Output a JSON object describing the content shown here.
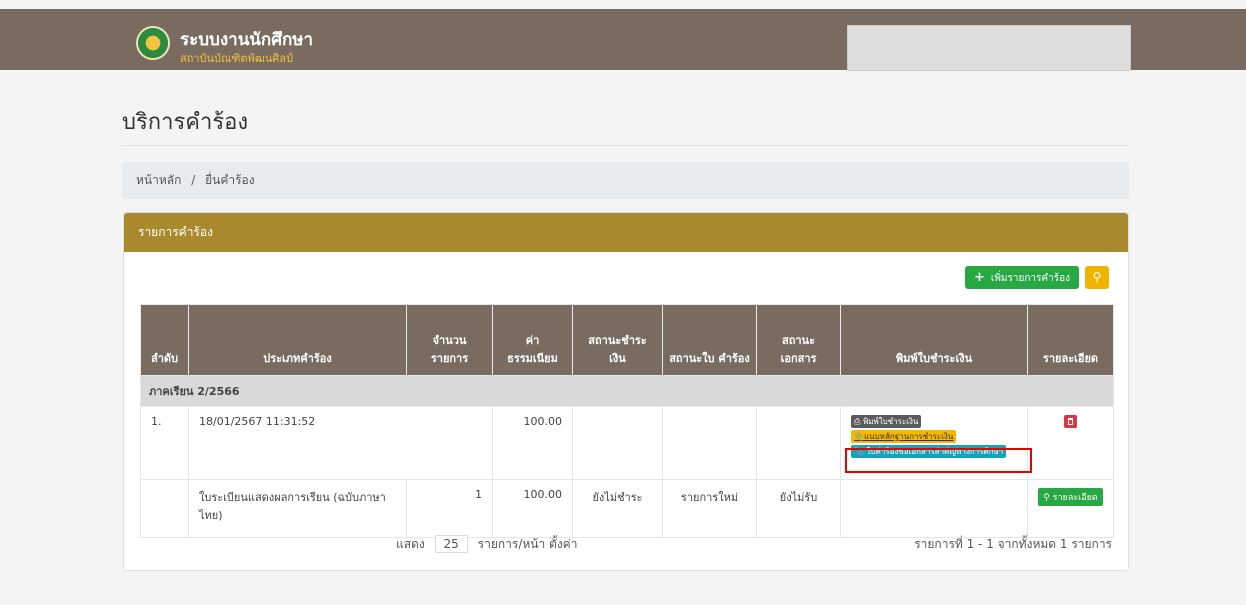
{
  "header": {
    "title": "ระบบงานนักศึกษา",
    "subtitle": "สถาบันบัณฑิตพัฒนศิลป์"
  },
  "page": {
    "title": "บริการคำร้อง"
  },
  "breadcrumb": {
    "home": "หน้าหลัก",
    "separator": "/",
    "current": "ยื่นคำร้อง"
  },
  "card": {
    "title": "รายการคำร้อง",
    "add_button": "เพิ่มรายการคำร้อง",
    "search_icon": "search-icon"
  },
  "table": {
    "headers": [
      "ลำดับ",
      "ประเภทคำร้อง",
      "จำนวน รายการ",
      "ค่า ธรรมเนียม",
      "สถานะชำระ เงิน",
      "สถานะใบ คำร้อง",
      "สถานะ เอกสาร",
      "พิมพ์ใบชำระเงิน",
      "รายละเอียด"
    ],
    "term": "ภาคเรียน 2/2566",
    "order": {
      "no": "1.",
      "datetime": "18/01/2567 11:31:52",
      "fee": "100.00",
      "print_payment": "พิมพ์ใบชำระเงิน",
      "attach_evidence": "แนบหลักฐานการชำระเงิน",
      "request_form": "ใบคำร้องขอเอกสารสำคัญทางการศึกษา"
    },
    "item": {
      "type": "ใบระเบียนแสดงผลการเรียน (ฉบับภาษาไทย)",
      "qty": "1",
      "fee": "100.00",
      "payment_status": "ยังไม่ชำระ",
      "request_status": "รายการใหม่",
      "document_status": "ยังไม่รับ",
      "detail_button": "รายละเอียด"
    }
  },
  "pager": {
    "show_label": "แสดง",
    "page_size": "25",
    "per_page_label": "รายการ/หน้า ตั้งค่า",
    "summary": "รายการที่ 1 - 1 จากทั้งหมด 1 รายการ"
  }
}
